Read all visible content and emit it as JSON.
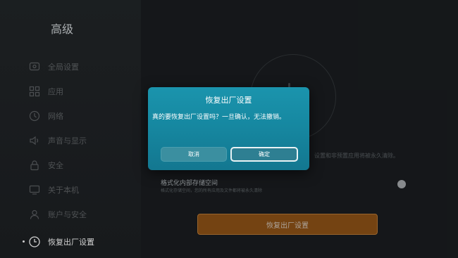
{
  "page": {
    "title": "高级"
  },
  "sidebar": {
    "items": [
      {
        "label": "全局设置",
        "icon": "display-icon"
      },
      {
        "label": "应用",
        "icon": "grid-icon"
      },
      {
        "label": "网络",
        "icon": "clock-icon"
      },
      {
        "label": "声音与显示",
        "icon": "speaker-icon"
      },
      {
        "label": "安全",
        "icon": "lock-icon"
      },
      {
        "label": "关于本机",
        "icon": "screen-icon"
      },
      {
        "label": "账户与安全",
        "icon": "user-icon"
      },
      {
        "label": "恢复出厂设置",
        "icon": "restore-icon",
        "active": true
      }
    ]
  },
  "main": {
    "background_description": "设置和非预置应用将被永久清除。",
    "format_title": "格式化内部存储空间",
    "format_description": "格式化存储空间，您的所有应用及文件都将被永久清除",
    "reset_button_label": "恢复出厂设置"
  },
  "dialog": {
    "title": "恢复出厂设置",
    "message": "真的要恢复出厂设置吗？一旦确认，无法撤销。",
    "cancel_label": "取消",
    "confirm_label": "确定"
  },
  "colors": {
    "dialog_bg": "#1688a1",
    "reset_button": "#a35c16",
    "background": "#1f2326"
  }
}
